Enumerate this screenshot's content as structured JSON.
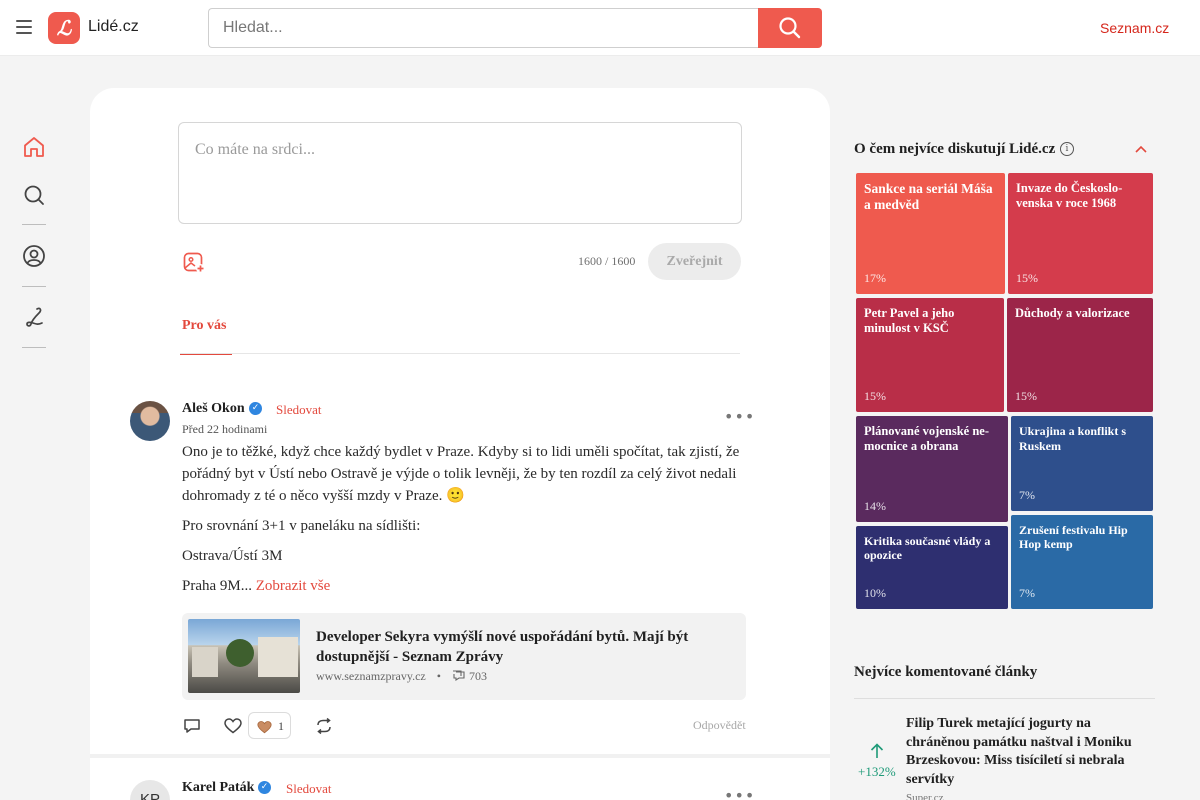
{
  "header": {
    "logo_letter": "ℒ",
    "logo_text": "Lidé.cz",
    "search_placeholder": "Hledat...",
    "seznam_link": "Seznam.cz"
  },
  "rail": {
    "items": [
      "home-icon",
      "search-icon",
      "profile-icon",
      "lide-logo-icon"
    ]
  },
  "composer": {
    "placeholder": "Co máte na srdci...",
    "counter": "1600 / 1600",
    "publish_label": "Zveřejnit"
  },
  "tabs": {
    "active": "Pro vás"
  },
  "posts": [
    {
      "author": "Aleš Okon",
      "follow": "Sledovat",
      "time": "Před 22 hodinami",
      "paragraphs": [
        "Ono je to těžké, když chce každý bydlet v Praze. Kdyby si to lidi uměli spočítat, tak zjistí, že pořádný byt v Ústí nebo Ostravě je výjde o tolik levněji, že by ten rozdíl za celý život nedali dohromady z té o něco vyšší mzdy v Praze. 🙂",
        "Pro srovnání 3+1 v paneláku na sídlišti:",
        "Ostrava/Ústí 3M",
        "Praha 9M..."
      ],
      "show_all": "Zobrazit vše",
      "link": {
        "title": "Developer Sekyra vymýšlí nové uspořádání bytů. Mají být dostupnější - Seznam Zprávy",
        "domain": "www.seznamzpravy.cz",
        "separator": "•",
        "comments": "703"
      },
      "reaction_count": "1",
      "reply_label": "Odpovědět"
    },
    {
      "author": "Karel Paták",
      "initials": "KP",
      "follow": "Sledovat"
    }
  ],
  "discussions": {
    "heading": "O čem nejvíce diskutují Lidé.cz",
    "info": "i",
    "tiles": [
      {
        "title": "Sankce na seriál Máša a medvěd",
        "percent": "17%",
        "color": "#ef5a4e"
      },
      {
        "title": "Invaze do Českoslo-venska v roce 1968",
        "percent": "15%",
        "color": "#d43c4c"
      },
      {
        "title": "Petr Pavel a jeho minulost v KSČ",
        "percent": "15%",
        "color": "#b92e48"
      },
      {
        "title": "Důchody a valorizace",
        "percent": "15%",
        "color": "#9c2549"
      },
      {
        "title": "Plánované vojenské ne-mocnice a obrana",
        "percent": "14%",
        "color": "#5a2a5e"
      },
      {
        "title": "Ukrajina a konflikt s Ruskem",
        "percent": "7%",
        "color": "#2e4f8c"
      },
      {
        "title": "Kritika současné vlády a opozice",
        "percent": "10%",
        "color": "#2e2f70"
      },
      {
        "title": "Zrušení festivalu Hip Hop kemp",
        "percent": "7%",
        "color": "#2a6aa6"
      }
    ]
  },
  "articles": {
    "heading": "Nejvíce komentované články",
    "items": [
      {
        "trend": "+132%",
        "title": "Filip Turek metající jogurty na chráněnou památku naštval i Moniku Brzeskovou: Miss tisíciletí si nebrala servítky",
        "source": "Super.cz"
      }
    ]
  },
  "colors": {
    "accent": "#ef5a4e",
    "link_red": "#d5261b",
    "trend_green": "#1e9a78"
  }
}
